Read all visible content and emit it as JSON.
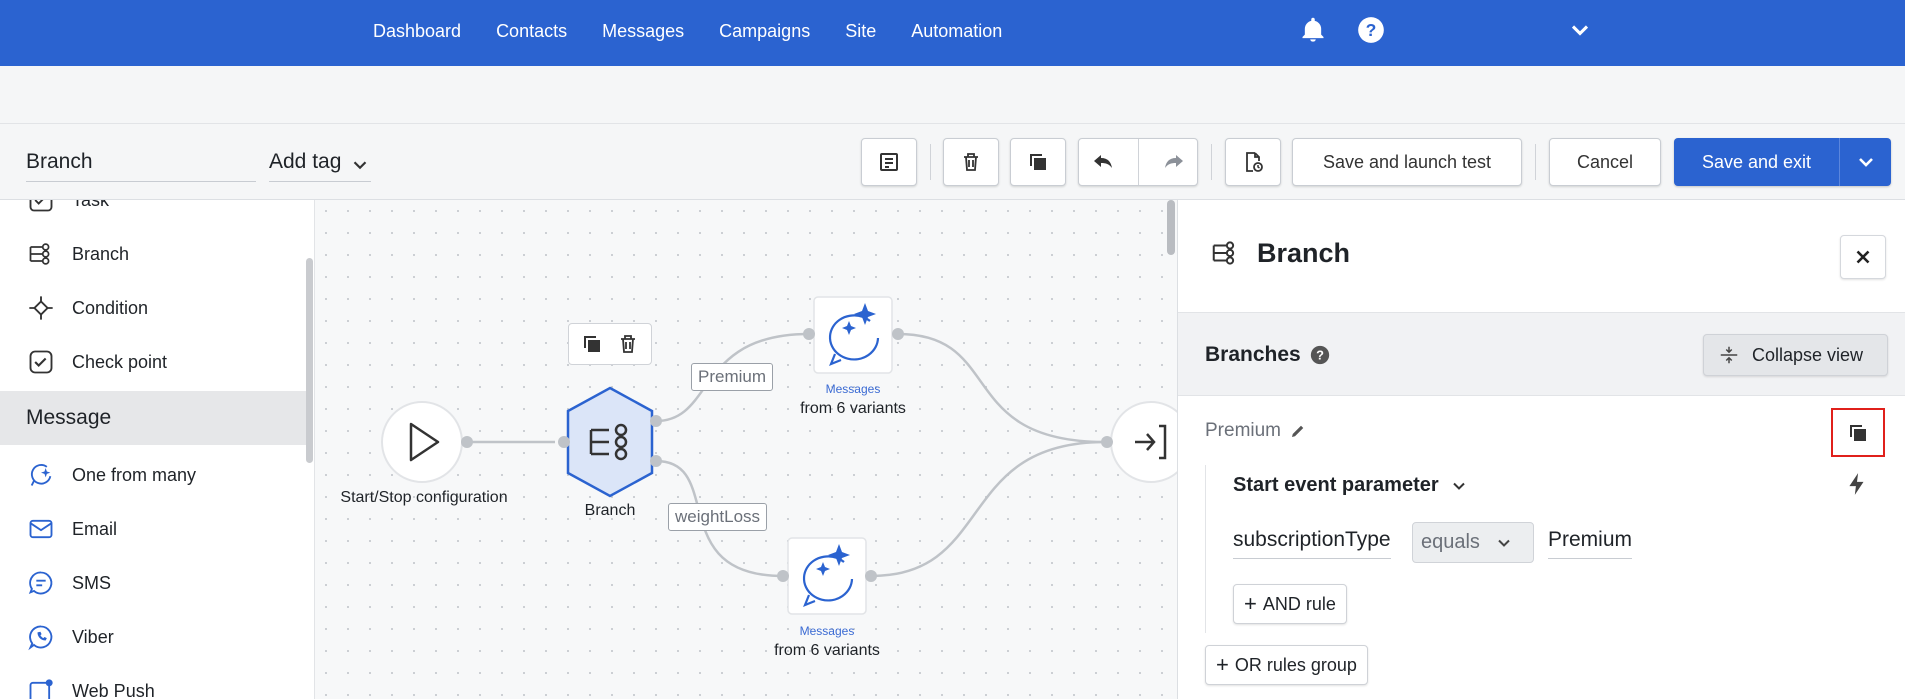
{
  "nav": {
    "links": [
      "Dashboard",
      "Contacts",
      "Messages",
      "Campaigns",
      "Site",
      "Automation"
    ]
  },
  "toolbar": {
    "name_value": "Branch",
    "tag_label": "Add tag",
    "save_launch_label": "Save and launch test",
    "cancel_label": "Cancel",
    "save_exit_label": "Save and exit"
  },
  "palette": {
    "items_top": [
      "Task",
      "Branch",
      "Condition",
      "Check point"
    ],
    "section": "Message",
    "items_bottom": [
      "One from many",
      "Email",
      "SMS",
      "Viber",
      "Web Push"
    ]
  },
  "canvas": {
    "start_label": "Start/Stop configuration",
    "branch_label": "Branch",
    "edge_premium": "Premium",
    "edge_weight": "weightLoss",
    "msg_top_sub": "Messages",
    "msg_top_label": "from 6 variants",
    "msg_bottom_sub": "Messages",
    "msg_bottom_label": "from 6 variants"
  },
  "panel": {
    "title": "Branch",
    "branches_title": "Branches",
    "collapse_label": "Collapse view",
    "branch_name": "Premium",
    "param_title": "Start event parameter",
    "rule_field": "subscriptionType",
    "rule_operator": "equals",
    "rule_value": "Premium",
    "and_rule_label": "AND rule",
    "or_group_label": "OR rules group"
  },
  "colors": {
    "brand": "#2b63d0",
    "highlight": "#e0201b"
  }
}
